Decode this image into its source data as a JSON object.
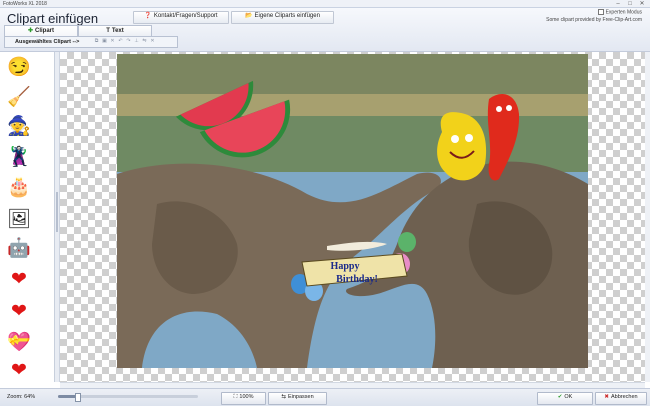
{
  "window": {
    "title": "FotoWorks XL 2018",
    "minimize": "–",
    "maximize": "□",
    "close": "✕"
  },
  "dialog_title": "Clipart einfügen",
  "top_buttons": {
    "contact": {
      "icon": "❓",
      "label": "Kontakt/Fragen/Support"
    },
    "own_cliparts": {
      "icon": "📂",
      "label": "Eigene Cliparts einfügen"
    }
  },
  "expert_mode": {
    "label": "Experten Modus",
    "checked": false
  },
  "credit": "Some clipart provided by Free-Clip-Art.com",
  "tabs": [
    {
      "icon": "✚",
      "label": "Clipart"
    },
    {
      "icon": "T",
      "label": "Text"
    }
  ],
  "selected_clipart_label": "Ausgewähltes Clipart -->",
  "toolbar_icons": [
    "copy-icon",
    "paste-icon",
    "delete-icon",
    "undo-icon",
    "redo-icon",
    "pin-icon",
    "mirror-icon",
    "close-icon"
  ],
  "toolbar_glyphs": [
    "⧉",
    "▣",
    "✕",
    "↶",
    "↷",
    "⊥",
    "⇋",
    "✕"
  ],
  "sidebar_cliparts": [
    {
      "name": "smiley-hat",
      "glyph": "😏"
    },
    {
      "name": "witch-broom",
      "glyph": "🧹"
    },
    {
      "name": "witch-purple",
      "glyph": "🧙"
    },
    {
      "name": "witch-black",
      "glyph": "🦹"
    },
    {
      "name": "birthday-cake",
      "glyph": "🎂"
    },
    {
      "name": "photo-frame",
      "glyph": "🖼"
    },
    {
      "name": "robot",
      "glyph": "🤖"
    },
    {
      "name": "heart-red",
      "glyph": "❤"
    },
    {
      "name": "heart-red-2",
      "glyph": "❤"
    },
    {
      "name": "heart-gift",
      "glyph": "💝"
    },
    {
      "name": "heart-small",
      "glyph": "❤"
    }
  ],
  "photo_cliparts": {
    "banner_line1": "Happy",
    "banner_line2": "Birthday!"
  },
  "footer": {
    "zoom_label": "Zoom: 64%",
    "zoom_value": 0.64,
    "btn_100": {
      "icon": "⛶",
      "label": "100%"
    },
    "btn_fit": {
      "icon": "⇆",
      "label": "Einpassen"
    },
    "btn_ok": {
      "icon": "✔",
      "label": "OK"
    },
    "btn_cancel": {
      "icon": "✖",
      "label": "Abbrechen"
    }
  },
  "colors": {
    "accent": "#2e6fc9",
    "ok_green": "#2d9b2d",
    "cancel_red": "#cc2a2a",
    "help_red": "#d0302a"
  }
}
